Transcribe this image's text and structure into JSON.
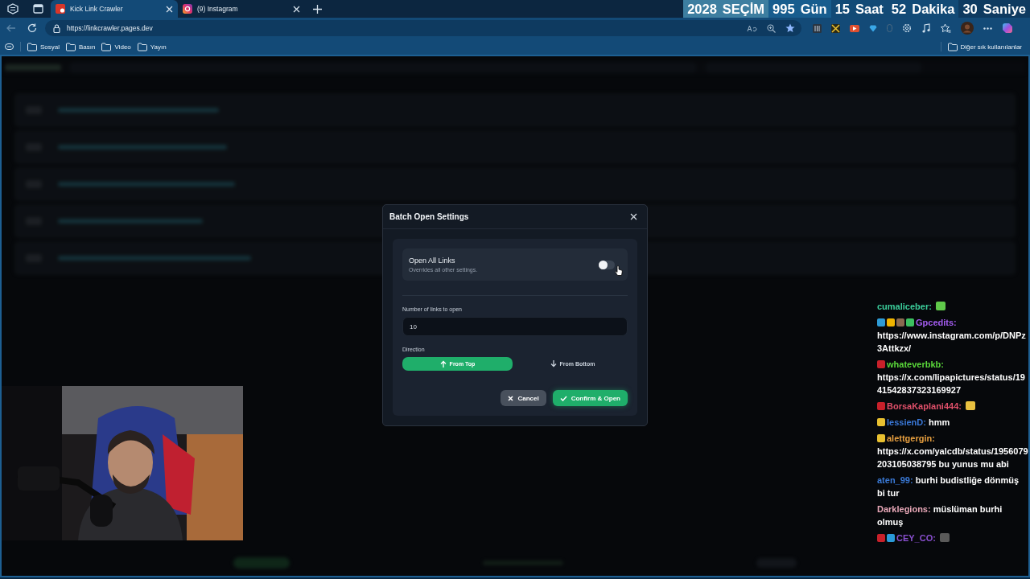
{
  "browser": {
    "tabs": [
      {
        "title": "Kick Link Crawler",
        "selected": true
      },
      {
        "title": "(9) Instagram",
        "selected": false
      }
    ],
    "url": "https://linkcrawler.pages.dev",
    "bookmarks": [
      "Sosyal",
      "Basın",
      "Video",
      "Yayın"
    ],
    "other_bookmarks": "Diğer sık kullanılanlar"
  },
  "countdown": [
    {
      "value": "2028",
      "unit": "SEÇİM"
    },
    {
      "value": "995",
      "unit": "Gün"
    },
    {
      "value": "15",
      "unit": "Saat"
    },
    {
      "value": "52",
      "unit": "Dakika"
    },
    {
      "value": "30",
      "unit": "Saniye"
    }
  ],
  "modal": {
    "title": "Batch Open Settings",
    "toggle": {
      "label": "Open All Links",
      "hint": "Overrides all other settings.",
      "on": false
    },
    "count": {
      "label": "Number of links to open",
      "value": "10"
    },
    "direction": {
      "label": "Direction",
      "options": [
        {
          "label": "From Top",
          "kind": "up",
          "selected": true
        },
        {
          "label": "From Bottom",
          "kind": "down",
          "selected": false
        }
      ]
    },
    "buttons": [
      {
        "label": "Cancel",
        "kind": "cancel"
      },
      {
        "label": "Confirm & Open",
        "kind": "confirm"
      }
    ]
  },
  "chat": [
    {
      "user": "cumaliceber:",
      "color": "#3ccf9c",
      "emote": {
        "color": "#5fc94a"
      }
    },
    {
      "badges": [
        {
          "color": "#2e9bd6"
        },
        {
          "color": "#f0b400"
        },
        {
          "color": "#8a6a50"
        },
        {
          "color": "#3cc060"
        }
      ],
      "user": "Gpcedits:",
      "color": "#a35cf0",
      "text": "https://www.instagram.com/p/DNPz3Attkzx/"
    },
    {
      "badges": [
        {
          "color": "#c8202a"
        }
      ],
      "user": "whateverbkb:",
      "color": "#5ad83a",
      "text": "https://x.com/lipapictures/status/1941542837323169927"
    },
    {
      "badges": [
        {
          "color": "#c8202a"
        }
      ],
      "user": "BorsaKaplani444:",
      "color": "#e0506a",
      "emote": {
        "color": "#e8c040"
      }
    },
    {
      "badges": [
        {
          "color": "#e8c030"
        }
      ],
      "user": "lessienD:",
      "color": "#3a78d8",
      "text": "hmm"
    },
    {
      "badges": [
        {
          "color": "#e8c030"
        }
      ],
      "user": "alettgergin:",
      "color": "#e8a040",
      "text": "https://x.com/yalcdb/status/1956079203105038795 bu yunus mu abi"
    },
    {
      "user": "aten_99:",
      "color": "#3a7ad8",
      "text": "burhi budistliğe dönmüş bi tur"
    },
    {
      "user": "Darklegions:",
      "color": "#e8a8b8",
      "text": "müslüman burhi olmuş"
    },
    {
      "badges": [
        {
          "color": "#c8202a"
        },
        {
          "color": "#2a9ad8"
        }
      ],
      "user": "CEY_CO:",
      "color": "#8a50d0",
      "emote": {
        "color": "#5a5a5a"
      }
    }
  ]
}
